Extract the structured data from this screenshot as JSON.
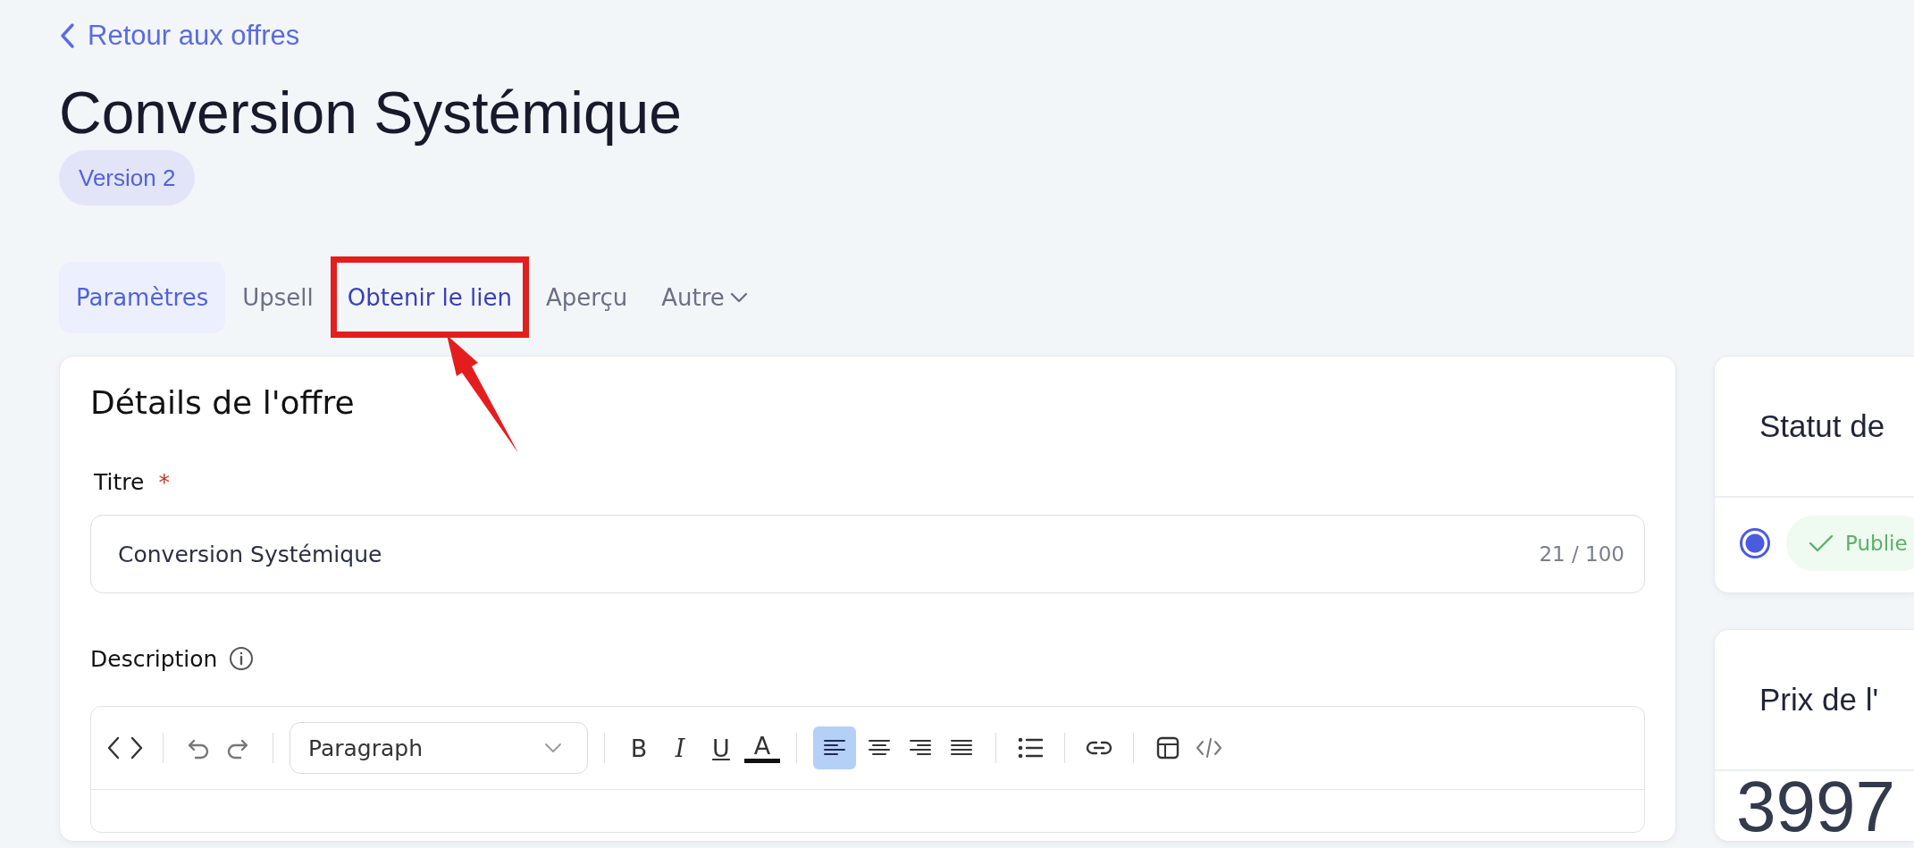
{
  "back_link": {
    "label": "Retour aux offres"
  },
  "title": "Conversion Systémique",
  "version_badge": "Version 2",
  "tabs": [
    {
      "label": "Paramètres",
      "kind": "tab",
      "selected": true,
      "highlighted": false
    },
    {
      "label": "Upsell",
      "kind": "tab",
      "selected": false,
      "highlighted": false
    },
    {
      "label": "Obtenir le lien",
      "kind": "tab",
      "selected": false,
      "highlighted": true
    },
    {
      "label": "Aperçu",
      "kind": "tab",
      "selected": false,
      "highlighted": false
    },
    {
      "label": "Autre",
      "kind": "menu",
      "selected": false,
      "highlighted": false
    }
  ],
  "offer_details": {
    "heading": "Détails de l'offre",
    "title_field": {
      "label": "Titre",
      "required_mark": "*",
      "value": "Conversion Systémique",
      "counter": "21 / 100"
    },
    "description": {
      "label": "Description",
      "toolbar": [
        {
          "items": [
            {
              "kind": "source"
            }
          ]
        },
        {
          "items": [
            {
              "kind": "undo"
            },
            {
              "kind": "redo"
            }
          ]
        },
        {
          "items": [
            {
              "kind": "select",
              "value": "Paragraph"
            }
          ]
        },
        {
          "items": [
            {
              "kind": "bold",
              "text": "B"
            },
            {
              "kind": "italic",
              "text": "I"
            },
            {
              "kind": "underline",
              "text": "U"
            },
            {
              "kind": "color",
              "text": "A"
            }
          ]
        },
        {
          "items": [
            {
              "kind": "align-left",
              "selected": true
            },
            {
              "kind": "align-center",
              "selected": false
            },
            {
              "kind": "align-right",
              "selected": false
            },
            {
              "kind": "justify",
              "selected": false
            }
          ]
        },
        {
          "items": [
            {
              "kind": "bullets"
            }
          ]
        },
        {
          "items": [
            {
              "kind": "link"
            }
          ]
        },
        {
          "items": [
            {
              "kind": "table"
            },
            {
              "kind": "code"
            }
          ]
        }
      ]
    }
  },
  "status_card": {
    "heading": "Statut de",
    "options": [
      {
        "label": "Publie",
        "selected": true
      }
    ]
  },
  "price_card": {
    "heading": "Prix de l'",
    "price": "3997"
  }
}
